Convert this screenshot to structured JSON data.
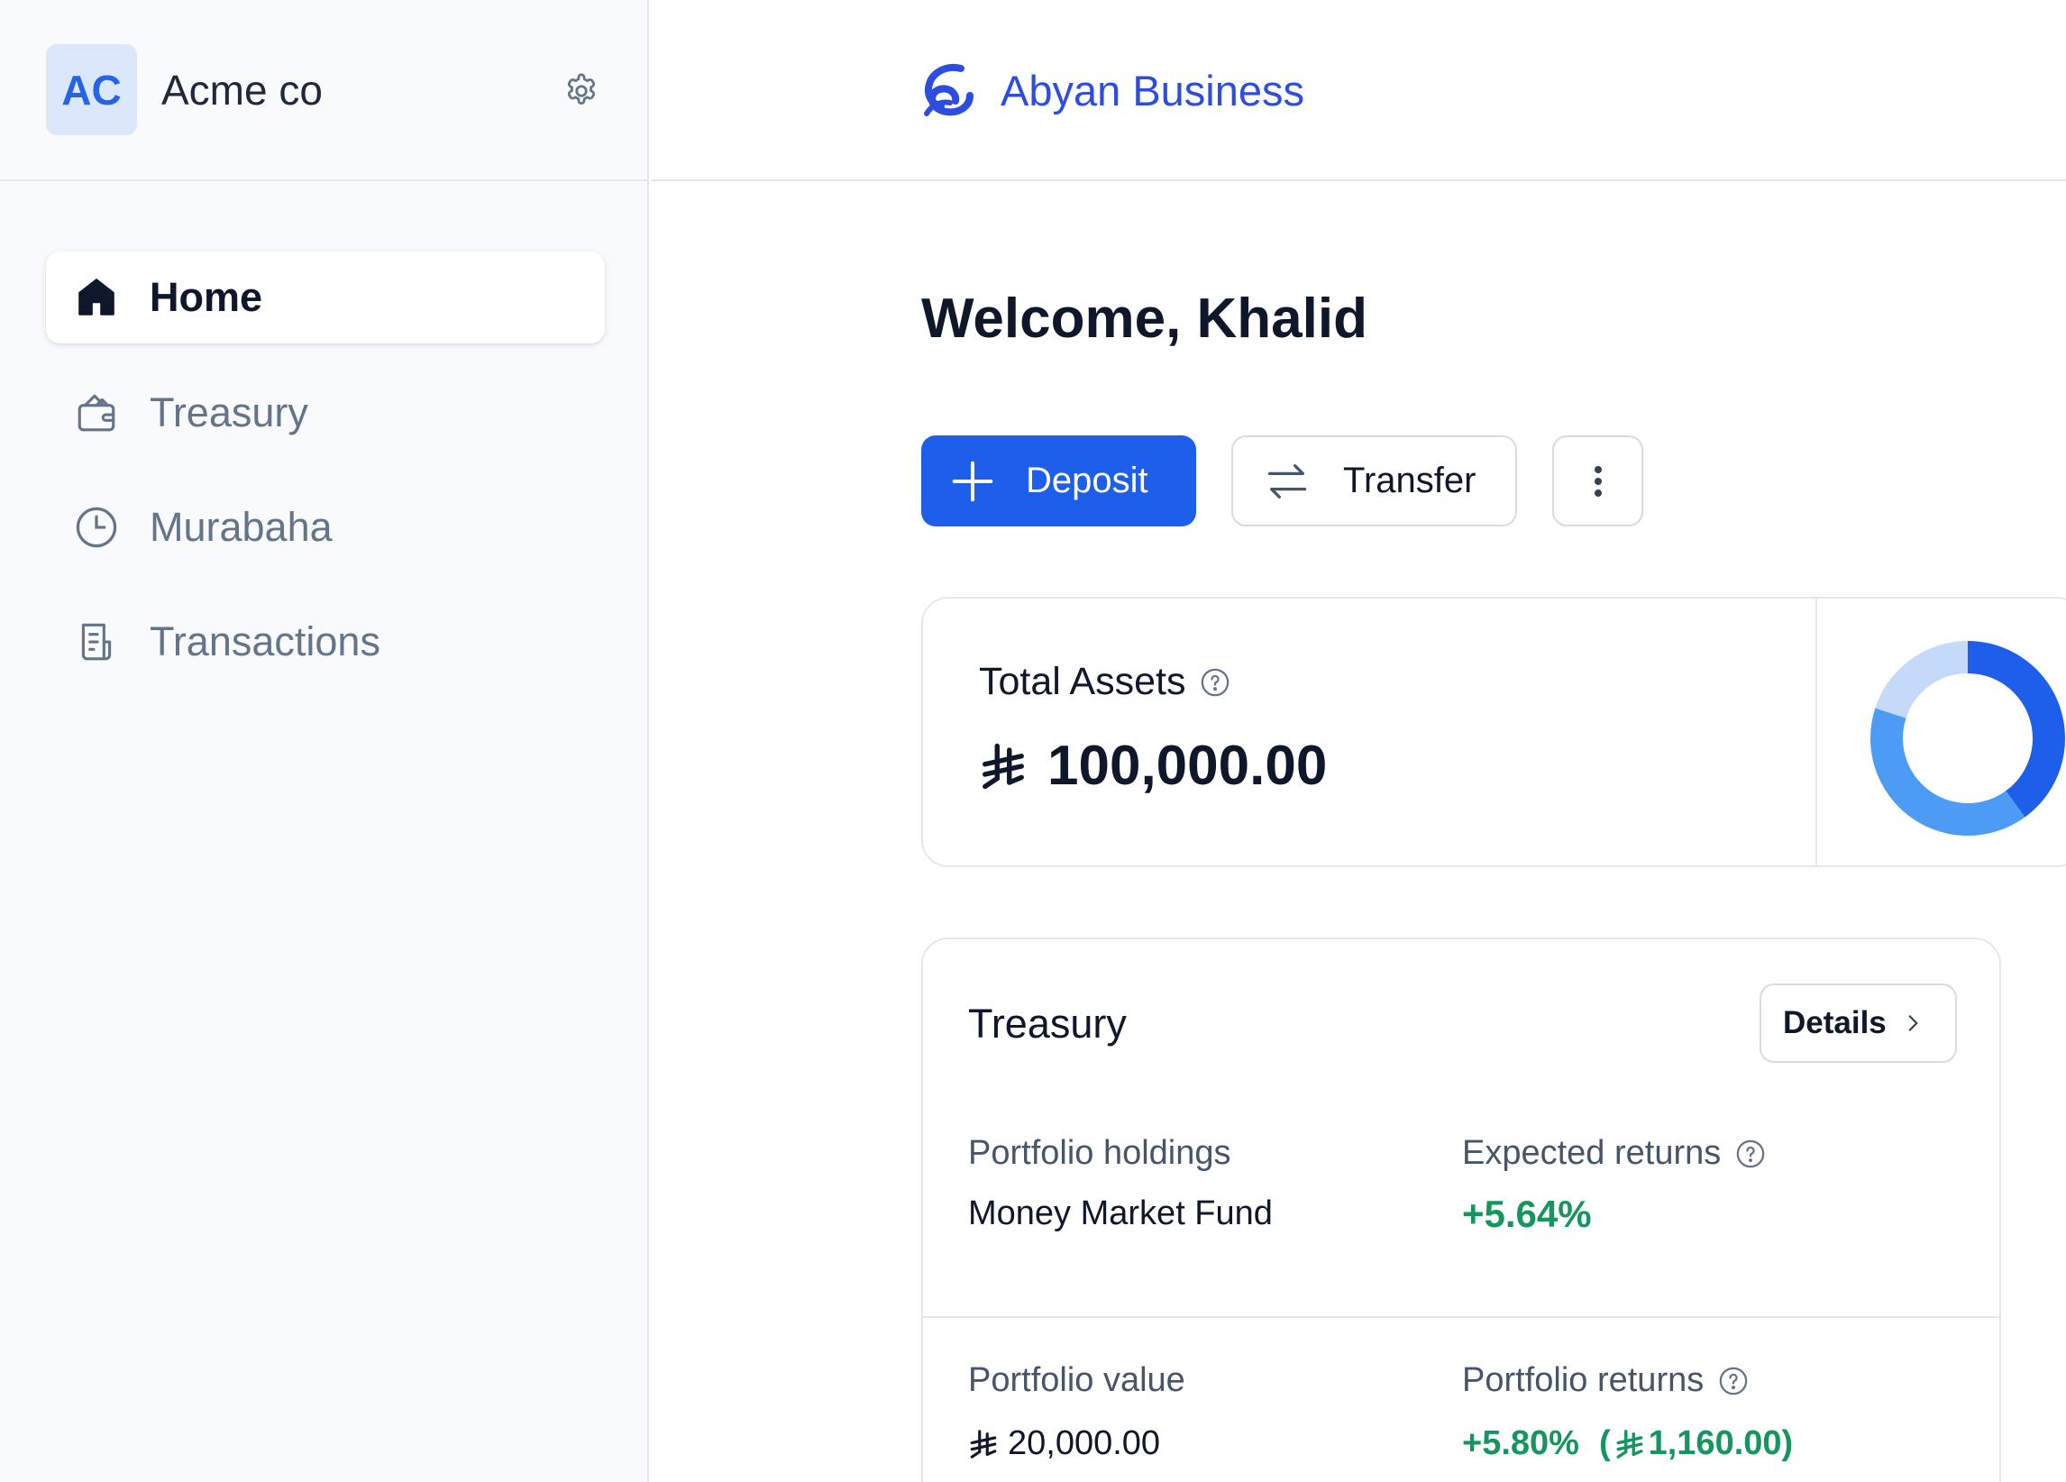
{
  "sidebar": {
    "org_initials": "AC",
    "org_name": "Acme co",
    "items": [
      {
        "label": "Home",
        "icon": "home-icon",
        "active": true
      },
      {
        "label": "Treasury",
        "icon": "wallet-icon",
        "active": false
      },
      {
        "label": "Murabaha",
        "icon": "clock-icon",
        "active": false
      },
      {
        "label": "Transactions",
        "icon": "receipt-icon",
        "active": false
      }
    ]
  },
  "topbar": {
    "brand_name": "Abyan Business"
  },
  "main": {
    "welcome": "Welcome, Khalid",
    "actions": {
      "deposit_label": "Deposit",
      "transfer_label": "Transfer"
    },
    "total_assets": {
      "title": "Total Assets",
      "amount": "100,000.00",
      "allocation_fractions": [
        0.4,
        0.4,
        0.2
      ]
    },
    "treasury": {
      "title": "Treasury",
      "details_label": "Details",
      "portfolio_holdings_label": "Portfolio holdings",
      "portfolio_holdings_value": "Money Market Fund",
      "expected_returns_label": "Expected returns",
      "expected_returns_value": "+5.64%",
      "portfolio_value_label": "Portfolio value",
      "portfolio_value": "20,000.00",
      "portfolio_returns_label": "Portfolio returns",
      "portfolio_returns_pct": "+5.80%",
      "portfolio_returns_open": "(",
      "portfolio_returns_amount": "1,160.00",
      "portfolio_returns_close": ")"
    }
  },
  "colors": {
    "primary": "#1d5fea",
    "brand": "#2d4de0",
    "positive": "#16955f",
    "donut_dark": "#1d5fea",
    "donut_mid": "#4c9bf5",
    "donut_light": "#c5d9f9"
  }
}
